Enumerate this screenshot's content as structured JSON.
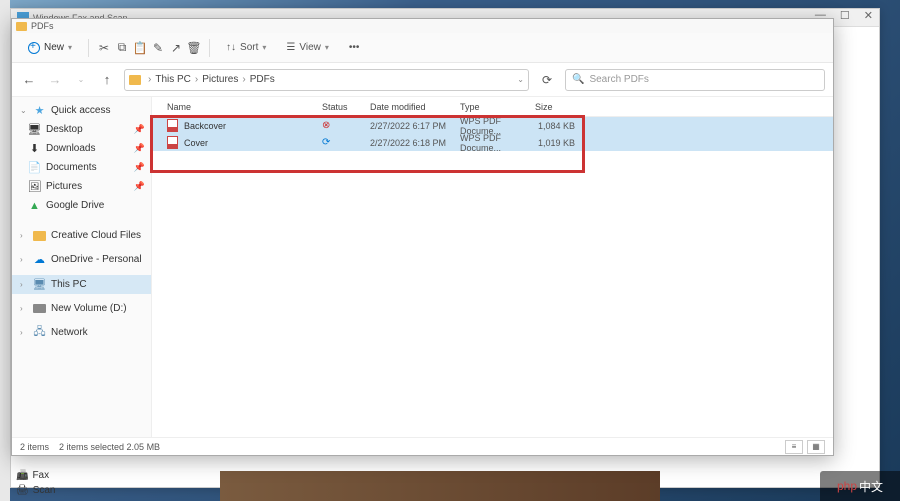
{
  "bg_window": {
    "title": "Windows Fax and Scan"
  },
  "bottom_items": [
    {
      "icon": "fax",
      "label": "Fax"
    },
    {
      "icon": "scan",
      "label": "Scan"
    }
  ],
  "explorer": {
    "title": "PDFs",
    "toolbar": {
      "new": "New",
      "sort": "Sort",
      "view": "View"
    },
    "breadcrumb": [
      "This PC",
      "Pictures",
      "PDFs"
    ],
    "search_placeholder": "Search PDFs",
    "columns": {
      "name": "Name",
      "status": "Status",
      "date": "Date modified",
      "type": "Type",
      "size": "Size"
    },
    "files": [
      {
        "name": "Backcover",
        "status": "error",
        "date": "2/27/2022 6:17 PM",
        "type": "WPS PDF Docume...",
        "size": "1,084 KB"
      },
      {
        "name": "Cover",
        "status": "sync",
        "date": "2/27/2022 6:18 PM",
        "type": "WPS PDF Docume...",
        "size": "1,019 KB"
      }
    ],
    "statusbar": {
      "count": "2 items",
      "selected": "2 items selected  2.05 MB"
    }
  },
  "sidebar": {
    "quick_access": "Quick access",
    "items": [
      {
        "label": "Desktop",
        "icon": "desktop"
      },
      {
        "label": "Downloads",
        "icon": "dl"
      },
      {
        "label": "Documents",
        "icon": "doc"
      },
      {
        "label": "Pictures",
        "icon": "pic"
      },
      {
        "label": "Google Drive",
        "icon": "gdrive"
      }
    ],
    "groups": [
      {
        "label": "Creative Cloud Files",
        "icon": "folder",
        "chevron": ">"
      },
      {
        "label": "OneDrive - Personal",
        "icon": "onedrive",
        "chevron": ">"
      },
      {
        "label": "This PC",
        "icon": "pc",
        "chevron": ">",
        "selected": true
      },
      {
        "label": "New Volume (D:)",
        "icon": "drive",
        "chevron": ">"
      },
      {
        "label": "Network",
        "icon": "network",
        "chevron": ">"
      }
    ]
  },
  "watermark": "php 中文"
}
